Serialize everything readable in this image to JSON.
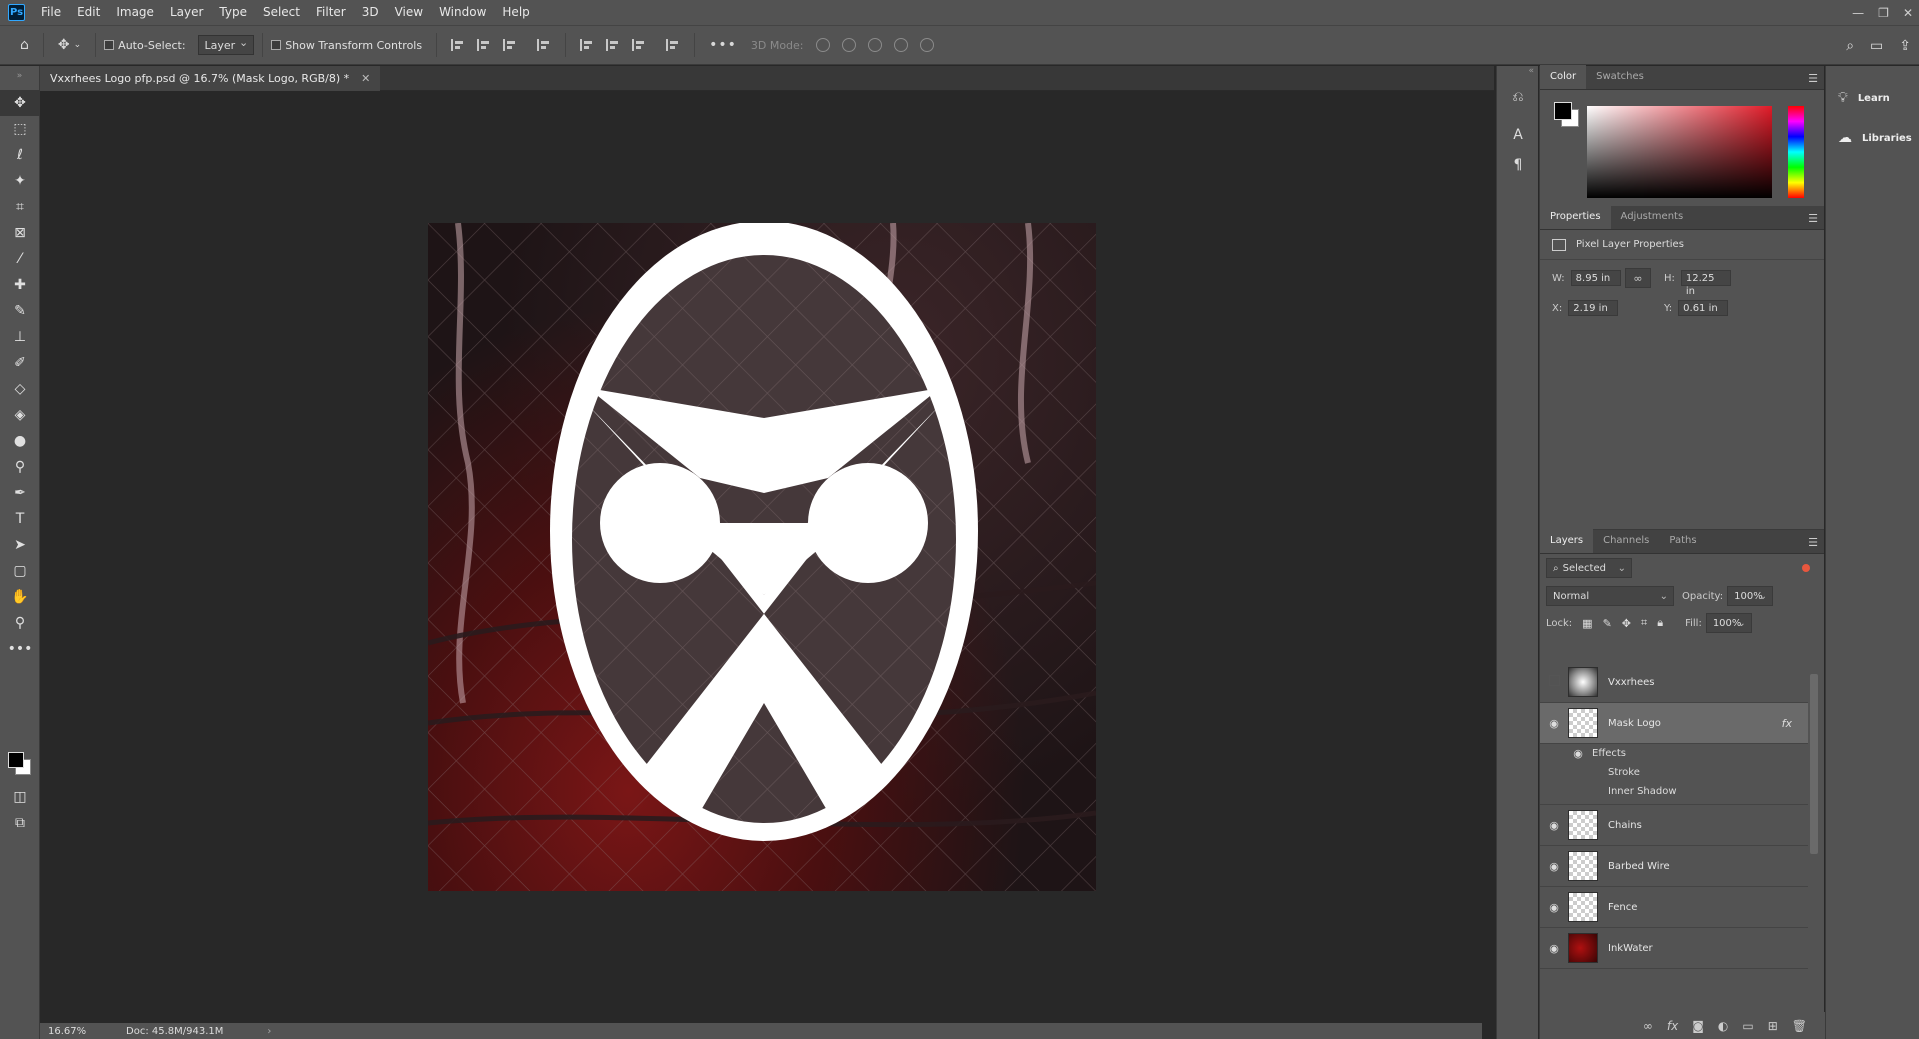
{
  "app": {
    "logo": "Ps"
  },
  "menu": [
    "File",
    "Edit",
    "Image",
    "Layer",
    "Type",
    "Select",
    "Filter",
    "3D",
    "View",
    "Window",
    "Help"
  ],
  "options": {
    "auto_select_label": "Auto-Select:",
    "auto_select_value": "Layer",
    "show_transform_label": "Show Transform Controls",
    "mode3d_label": "3D Mode:"
  },
  "document": {
    "tab_title": "Vxxrhees Logo pfp.psd @ 16.7% (Mask Logo, RGB/8) *",
    "zoom": "16.67%",
    "doc_size": "Doc: 45.8M/943.1M"
  },
  "color_panel": {
    "tabs": [
      "Color",
      "Swatches"
    ],
    "fg": "#000000",
    "bg": "#ffffff",
    "hue_color": "#e01b28"
  },
  "properties_panel": {
    "tabs": [
      "Properties",
      "Adjustments"
    ],
    "heading": "Pixel Layer Properties",
    "w_label": "W:",
    "w_value": "8.95 in",
    "h_label": "H:",
    "h_value": "12.25 in",
    "x_label": "X:",
    "x_value": "2.19 in",
    "y_label": "Y:",
    "y_value": "0.61 in"
  },
  "layers_panel": {
    "tabs": [
      "Layers",
      "Channels",
      "Paths"
    ],
    "filter": "Selected",
    "blend_mode": "Normal",
    "opacity_label": "Opacity:",
    "opacity_value": "100%",
    "lock_label": "Lock:",
    "fill_label": "Fill:",
    "fill_value": "100%",
    "layers": [
      {
        "name": "Vxxrhees",
        "visible": false,
        "thumb": "sphere"
      },
      {
        "name": "Mask Logo",
        "visible": true,
        "thumb": "transparent",
        "selected": true,
        "fx": "fx"
      },
      {
        "name": "Chains",
        "visible": true,
        "thumb": "transparent"
      },
      {
        "name": "Barbed Wire",
        "visible": true,
        "thumb": "transparent"
      },
      {
        "name": "Fence",
        "visible": true,
        "thumb": "transparent"
      },
      {
        "name": "InkWater",
        "visible": true,
        "thumb": "red"
      }
    ],
    "effects_label": "Effects",
    "effects": [
      "Stroke",
      "Inner Shadow"
    ]
  },
  "side_panels": {
    "learn": "Learn",
    "libraries": "Libraries"
  }
}
